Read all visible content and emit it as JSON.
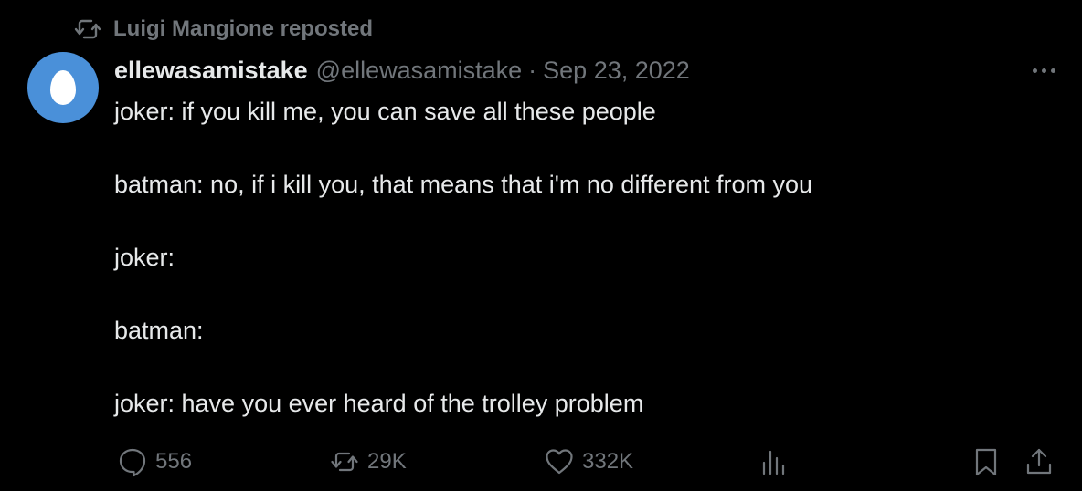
{
  "repost": {
    "text": "Luigi Mangione reposted",
    "icon": "repost-icon"
  },
  "author": {
    "display_name": "ellewasamistake",
    "handle": "@ellewasamistake",
    "separator": "·",
    "date": "Sep 23, 2022",
    "avatar_color": "#4a90d9"
  },
  "body": {
    "lines": [
      "joker: if you kill me, you can save all these people",
      "batman: no, if i kill you, that means that i'm no different from you",
      "joker:",
      "batman:",
      "joker: have you ever heard of the trolley problem"
    ]
  },
  "actions": {
    "replies": "556",
    "reposts": "29K",
    "likes": "332K"
  },
  "colors": {
    "background": "#000000",
    "text": "#e7e9ea",
    "muted": "#71767b"
  }
}
